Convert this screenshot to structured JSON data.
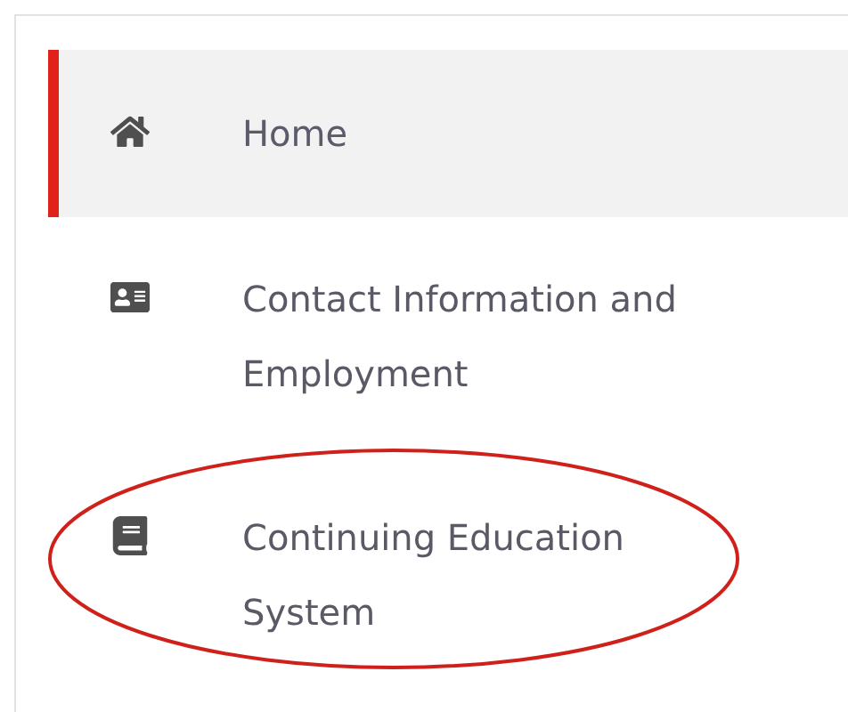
{
  "nav": {
    "items": [
      {
        "kind": "home",
        "label": "Home",
        "selected": true,
        "circled": false
      },
      {
        "kind": "contact",
        "label": "Contact Information and Employment",
        "selected": false,
        "circled": false
      },
      {
        "kind": "education",
        "label": "Continuing Education System",
        "selected": false,
        "circled": true
      }
    ]
  }
}
